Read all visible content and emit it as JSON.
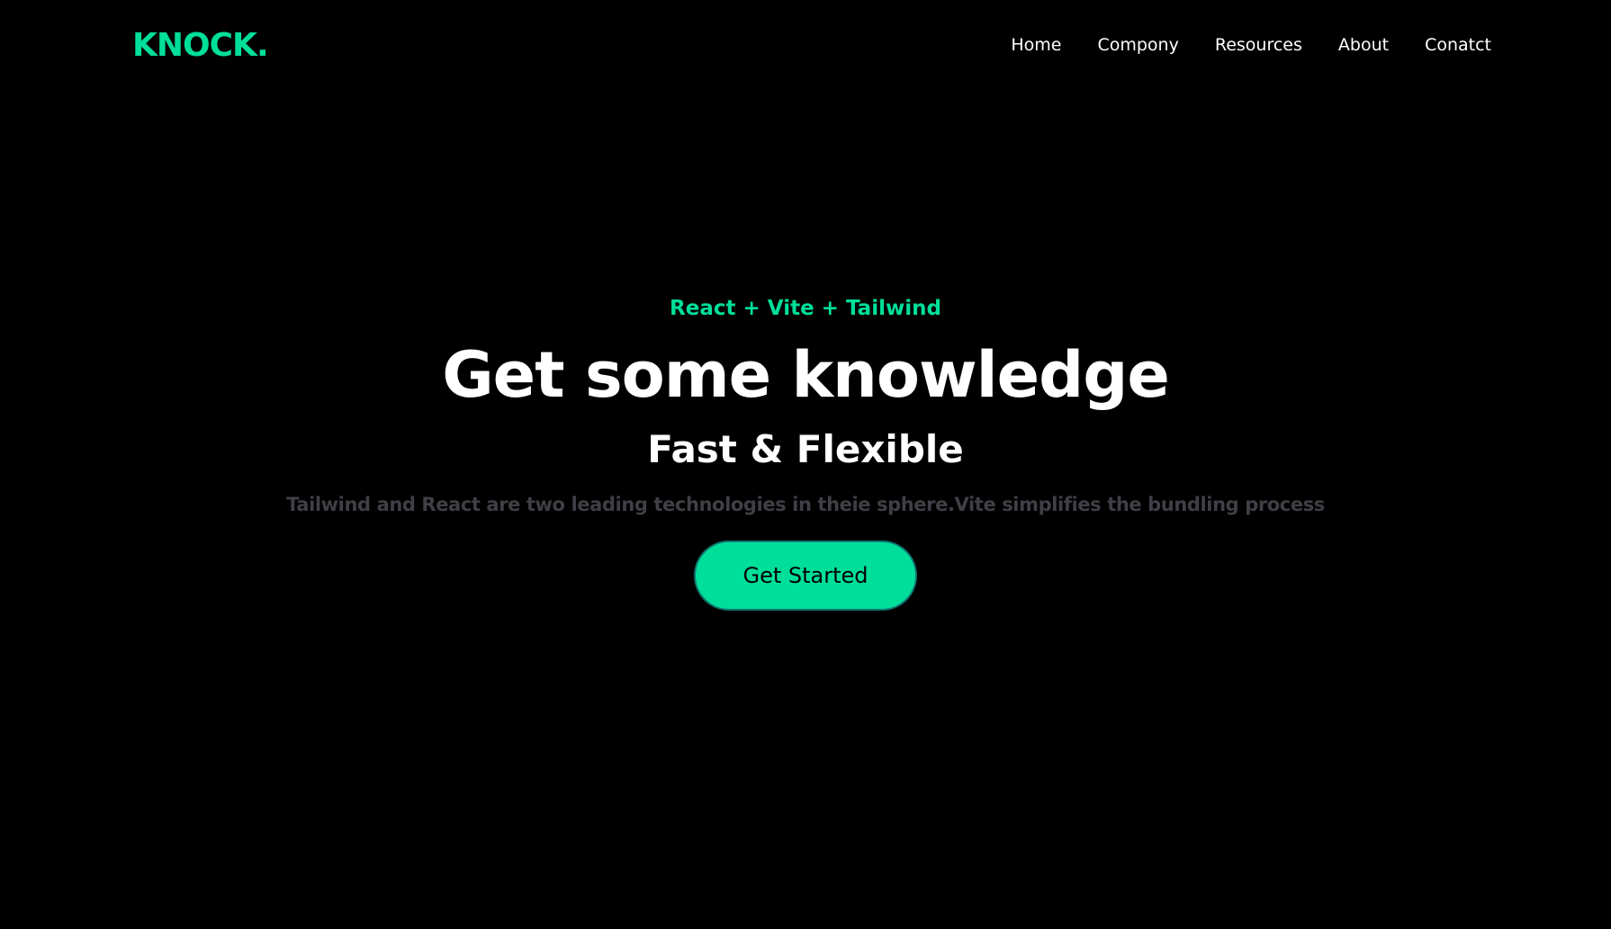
{
  "brand": {
    "logo": "KNOCK."
  },
  "nav": {
    "items": [
      "Home",
      "Compony",
      "Resources",
      "About",
      "Conatct"
    ]
  },
  "hero": {
    "eyebrow": "React + Vite + Tailwind",
    "headline": "Get some knowledge",
    "subheadline": "Fast & Flexible",
    "description": "Tailwind and React are two leading technologies in theie sphere.Vite simplifies the bundling process",
    "cta_label": "Get Started"
  },
  "colors": {
    "background": "#000000",
    "accent": "#00df9a",
    "text": "#ffffff",
    "muted": "#3f3f46"
  }
}
